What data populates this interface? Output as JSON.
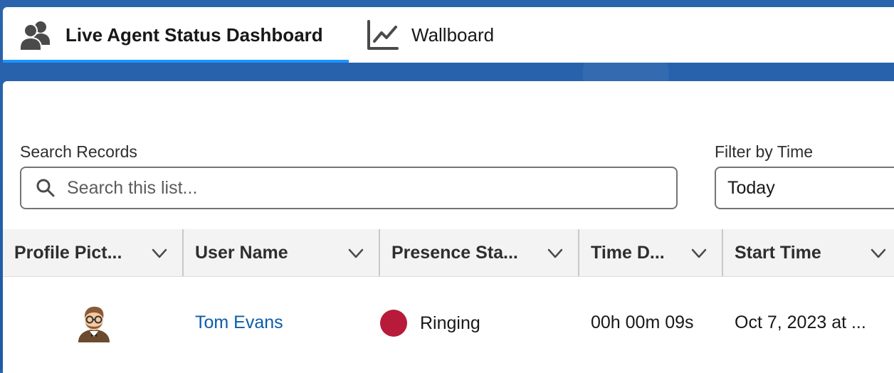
{
  "tabs": [
    {
      "label": "Live Agent Status Dashboard",
      "icon": "user-group-icon",
      "active": true
    },
    {
      "label": "Wallboard",
      "icon": "line-chart-icon",
      "active": false
    }
  ],
  "search": {
    "label": "Search Records",
    "placeholder": "Search this list..."
  },
  "filter": {
    "label": "Filter by Time",
    "value": "Today"
  },
  "table": {
    "columns": [
      {
        "label": "Profile Pict..."
      },
      {
        "label": "User Name"
      },
      {
        "label": "Presence Sta..."
      },
      {
        "label": "Time D..."
      },
      {
        "label": "Start Time"
      }
    ],
    "rows": [
      {
        "avatar": "avatar-icon",
        "user_name": "Tom Evans",
        "presence": "Ringing",
        "presence_color": "#b81a3a",
        "time_duration": "00h 00m 09s",
        "start_time": "Oct 7, 2023 at ..."
      }
    ]
  },
  "colors": {
    "accent": "#1b96ff",
    "link": "#0b5cab",
    "background": "#1f5aa6"
  }
}
